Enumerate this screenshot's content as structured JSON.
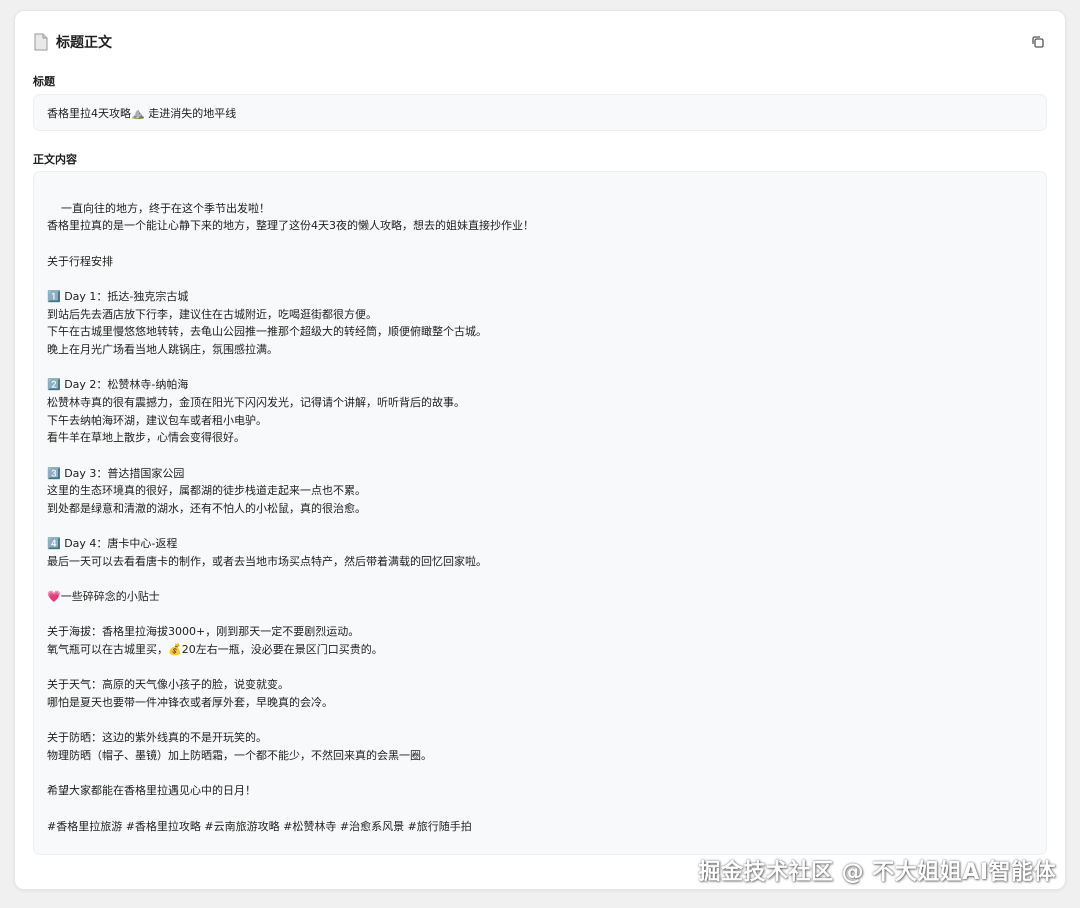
{
  "card": {
    "title": "标题正文",
    "icons": {
      "header": "document-icon",
      "copy": "copy-icon"
    }
  },
  "title_field": {
    "label": "标题",
    "value": "香格里拉4天攻略⛰️ 走进消失的地平线"
  },
  "body_field": {
    "label": "正文内容",
    "value": "一直向往的地方，终于在这个季节出发啦！\n香格里拉真的是一个能让心静下来的地方，整理了这份4天3夜的懒人攻略，想去的姐妹直接抄作业！\n\n关于行程安排\n\n1️⃣ Day 1：抵达-独克宗古城\n到站后先去酒店放下行李，建议住在古城附近，吃喝逛街都很方便。\n下午在古城里慢悠悠地转转，去龟山公园推一推那个超级大的转经筒，顺便俯瞰整个古城。\n晚上在月光广场看当地人跳锅庄，氛围感拉满。\n\n2️⃣ Day 2：松赞林寺-纳帕海\n松赞林寺真的很有震撼力，金顶在阳光下闪闪发光，记得请个讲解，听听背后的故事。\n下午去纳帕海环湖，建议包车或者租小电驴。\n看牛羊在草地上散步，心情会变得很好。\n\n3️⃣ Day 3：普达措国家公园\n这里的生态环境真的很好，属都湖的徒步栈道走起来一点也不累。\n到处都是绿意和清澈的湖水，还有不怕人的小松鼠，真的很治愈。\n\n4️⃣ Day 4：唐卡中心-返程\n最后一天可以去看看唐卡的制作，或者去当地市场买点特产，然后带着满载的回忆回家啦。\n\n💗一些碎碎念的小贴士\n\n关于海拔：香格里拉海拔3000+，刚到那天一定不要剧烈运动。\n氧气瓶可以在古城里买，💰20左右一瓶，没必要在景区门口买贵的。\n\n关于天气：高原的天气像小孩子的脸，说变就变。\n哪怕是夏天也要带一件冲锋衣或者厚外套，早晚真的会冷。\n\n关于防晒：这边的紫外线真的不是开玩笑的。\n物理防晒（帽子、墨镜）加上防晒霜，一个都不能少，不然回来真的会黑一圈。\n\n希望大家都能在香格里拉遇见心中的日月！\n\n#香格里拉旅游 #香格里拉攻略 #云南旅游攻略 #松赞林寺 #治愈系风景 #旅行随手拍"
  },
  "watermark": "掘金技术社区 @ 不大姐姐AI智能体"
}
